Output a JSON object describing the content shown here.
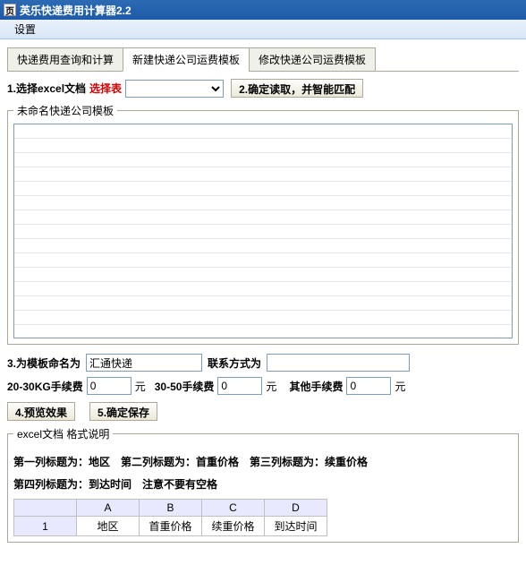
{
  "window": {
    "title": "英乐快递费用计算器2.2",
    "icon_text": "页"
  },
  "menu": {
    "settings": "设置"
  },
  "tabs": [
    {
      "label": "快递费用查询和计算"
    },
    {
      "label": "新建快递公司运费模板"
    },
    {
      "label": "修改快递公司运费模板"
    }
  ],
  "step1": {
    "label": "1.选择excel文档",
    "select_table": "选择表",
    "select_value": "",
    "step2_btn": "2.确定读取，并智能匹配"
  },
  "templatebox": {
    "legend": "未命名快递公司模板"
  },
  "step3": {
    "label": "3.为模板命名为",
    "template_name": "汇通快递",
    "contact_label": "联系方式为",
    "contact_value": ""
  },
  "fees": {
    "f20_30_label": "20-30KG手续费",
    "f20_30_value": "0",
    "unit": "元",
    "f30_50_label": "30-50手续费",
    "f30_50_value": "0",
    "other_label": "其他手续费",
    "other_value": "0"
  },
  "buttons": {
    "preview": "4.预览效果",
    "save": "5.确定保存"
  },
  "spec": {
    "legend": "excel文档 格式说明",
    "line1_a": "第一列标题为：地区",
    "line1_b": "第二列标题为：首重价格",
    "line1_c": "第三列标题为：续重价格",
    "line2_a": "第四列标题为：到达时间",
    "line2_b": "注意不要有空格",
    "cols": [
      "A",
      "B",
      "C",
      "D"
    ],
    "rownum": "1",
    "cells": [
      "地区",
      "首重价格",
      "续重价格",
      "到达时间"
    ]
  }
}
